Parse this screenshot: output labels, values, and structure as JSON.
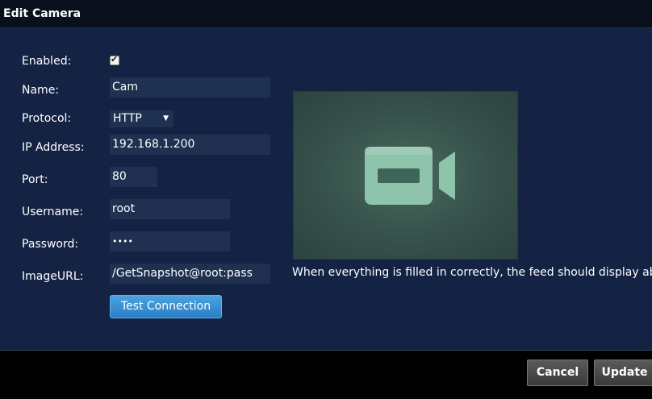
{
  "window": {
    "title": "Edit Camera"
  },
  "form": {
    "enabled": {
      "label": "Enabled:",
      "checked": true
    },
    "name": {
      "label": "Name:",
      "value": "Cam"
    },
    "protocol": {
      "label": "Protocol:",
      "value": "HTTP"
    },
    "ip": {
      "label": "IP Address:",
      "value": "192.168.1.200"
    },
    "port": {
      "label": "Port:",
      "value": "80"
    },
    "username": {
      "label": "Username:",
      "value": "root"
    },
    "password": {
      "label": "Password:",
      "value": "••••"
    },
    "image_url": {
      "label": "ImageURL:",
      "value": "/GetSnapshot@root:pass"
    },
    "test_button": "Test Connection"
  },
  "preview": {
    "icon": "video-camera-icon",
    "hint": "When everything is filled in correctly, the feed should display above."
  },
  "footer": {
    "cancel_label": "Cancel",
    "update_label": "Update"
  },
  "colors": {
    "background": "#142344",
    "field": "#1f3050",
    "accent": "#2a7fc4",
    "preview_bg": "#36504a",
    "icon": "#8fc4ac"
  }
}
